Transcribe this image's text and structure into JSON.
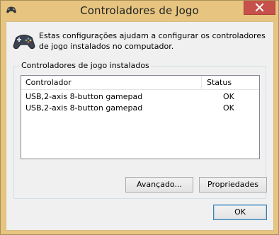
{
  "window": {
    "title": "Controladores de Jogo",
    "app_icon": "gamepad-icon",
    "close_icon": "close-icon"
  },
  "intro": {
    "icon": "gamepad-icon",
    "text": "Estas configurações ajudam a configurar os controladores de jogo instalados no computador."
  },
  "group": {
    "title": "Controladores de jogo instalados",
    "columns": [
      "Controlador",
      "Status"
    ],
    "rows": [
      {
        "controller": "USB,2-axis 8-button gamepad",
        "status": "OK"
      },
      {
        "controller": "USB,2-axis 8-button gamepad",
        "status": "OK"
      }
    ],
    "advanced_label": "Avançado...",
    "properties_label": "Propriedades"
  },
  "footer": {
    "ok_label": "OK"
  },
  "colors": {
    "frame": "#e7c580",
    "close_button": "#c6504a",
    "client": "#f0f0f0"
  }
}
